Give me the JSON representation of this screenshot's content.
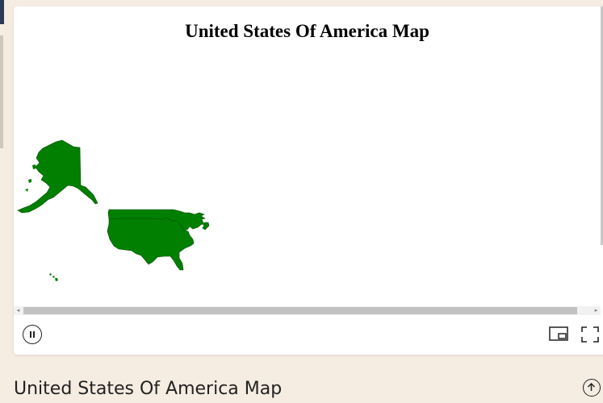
{
  "map": {
    "title": "United States Of America Map",
    "fill_color": "#007f00",
    "regions": [
      "alaska",
      "contiguous-united-states",
      "hawaii"
    ]
  },
  "player": {
    "pause_icon": "pause-icon",
    "pip_icon": "picture-in-picture-icon",
    "fullscreen_icon": "fullscreen-icon"
  },
  "footer": {
    "caption": "United States Of America Map",
    "up_icon": "arrow-up-circle-icon"
  }
}
